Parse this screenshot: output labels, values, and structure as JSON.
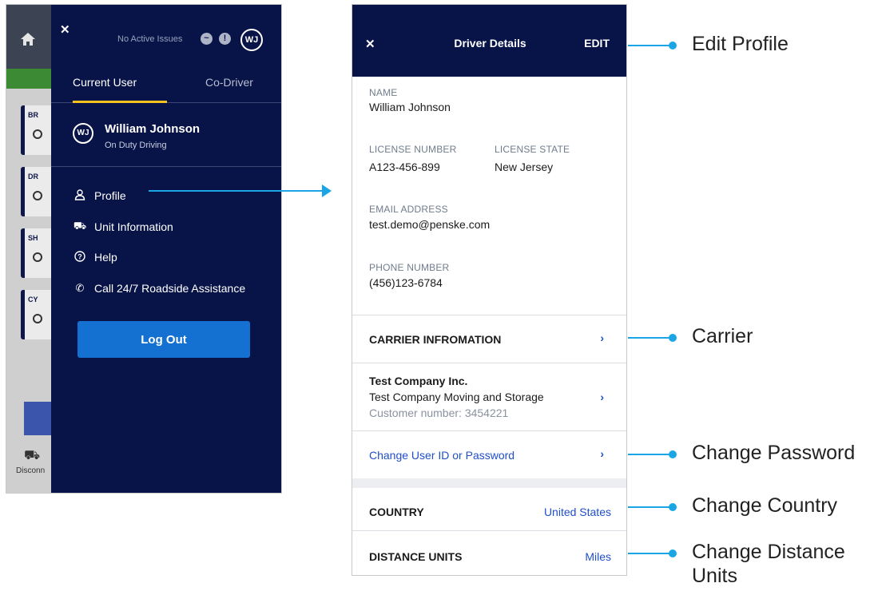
{
  "left_screen": {
    "background_tiles": [
      "BR",
      "DR",
      "SH",
      "CY"
    ],
    "background_footer_label": "Disconn",
    "header": {
      "status_text": "No Active Issues",
      "avatar_initials": "WJ"
    },
    "tabs": [
      {
        "label": "Current User",
        "active": true
      },
      {
        "label": "Co-Driver",
        "active": false
      }
    ],
    "user": {
      "initials": "WJ",
      "name": "William Johnson",
      "status": "On Duty Driving"
    },
    "menu": [
      {
        "icon": "person-icon",
        "label": "Profile"
      },
      {
        "icon": "truck-icon",
        "label": "Unit Information"
      },
      {
        "icon": "help-icon",
        "label": "Help"
      },
      {
        "icon": "phone-icon",
        "label": "Call 24/7 Roadside Assistance"
      }
    ],
    "logout_label": "Log Out"
  },
  "right_screen": {
    "header": {
      "title": "Driver Details",
      "edit_label": "EDIT"
    },
    "fields": {
      "name_label": "NAME",
      "name_value": "William Johnson",
      "license_number_label": "LICENSE NUMBER",
      "license_number_value": "A123-456-899",
      "license_state_label": "LICENSE STATE",
      "license_state_value": "New Jersey",
      "email_label": "EMAIL ADDRESS",
      "email_value": "test.demo@penske.com",
      "phone_label": "PHONE NUMBER",
      "phone_value": "(456)123-6784"
    },
    "carrier_section_title": "CARRIER INFROMATION",
    "carrier": {
      "company": "Test Company Inc.",
      "company_sub": "Test Company Moving and Storage",
      "customer_number": "Customer number: 3454221"
    },
    "change_credentials_label": "Change User ID or Password",
    "country": {
      "label": "COUNTRY",
      "value": "United States"
    },
    "distance_units": {
      "label": "DISTANCE UNITS",
      "value": "Miles"
    }
  },
  "annotations": {
    "edit_profile": "Edit Profile",
    "carrier": "Carrier",
    "change_password": "Change Password",
    "change_country": "Change Country",
    "change_distance_units": "Change Distance Units"
  },
  "colors": {
    "navy": "#081447",
    "accent_blue": "#1471d2",
    "link_blue": "#1f4fc9",
    "connector": "#1aa6e5",
    "tab_underline": "#f5c31b"
  }
}
